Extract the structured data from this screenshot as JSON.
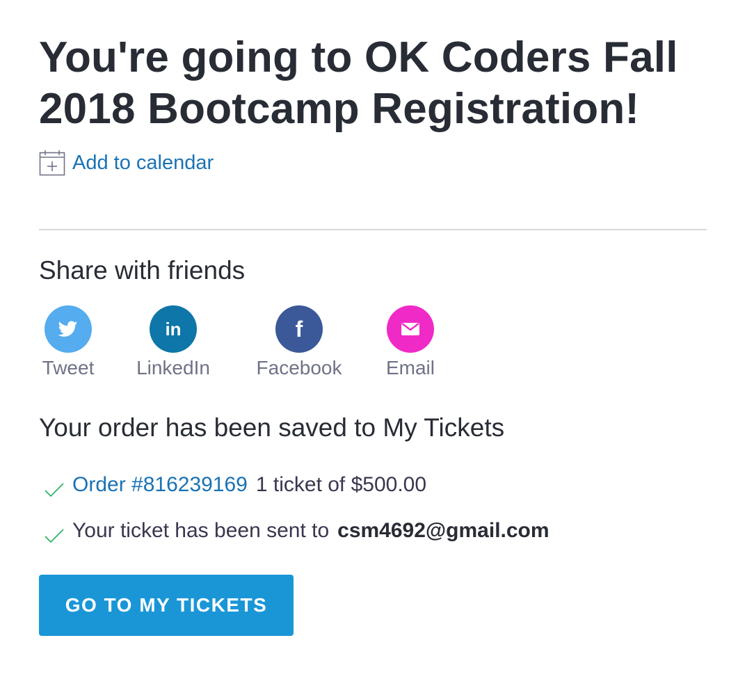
{
  "header": {
    "title_line1": "You're going to OK Coders Fall",
    "title_line2": "2018 Bootcamp Registration!",
    "add_to_calendar": "Add to calendar",
    "calendar_icon": "calendar-plus-icon"
  },
  "share": {
    "title": "Share with friends",
    "items": [
      {
        "label": "Tweet",
        "icon": "twitter-icon",
        "color": "#55acee"
      },
      {
        "label": "LinkedIn",
        "icon": "linkedin-icon",
        "color": "#0e76a8"
      },
      {
        "label": "Facebook",
        "icon": "facebook-icon",
        "color": "#3b5998"
      },
      {
        "label": "Email",
        "icon": "email-icon",
        "color": "#f02ac6"
      }
    ]
  },
  "order": {
    "title": "Your order has been saved to My Tickets",
    "order_link": "Order #816239169",
    "order_detail": "1 ticket of $500.00",
    "sent_text": "Your ticket has been sent to",
    "email": "csm4692@gmail.com",
    "check_color": "#31b36b"
  },
  "cta": {
    "label": "GO TO MY TICKETS",
    "color": "#1a96d6"
  }
}
